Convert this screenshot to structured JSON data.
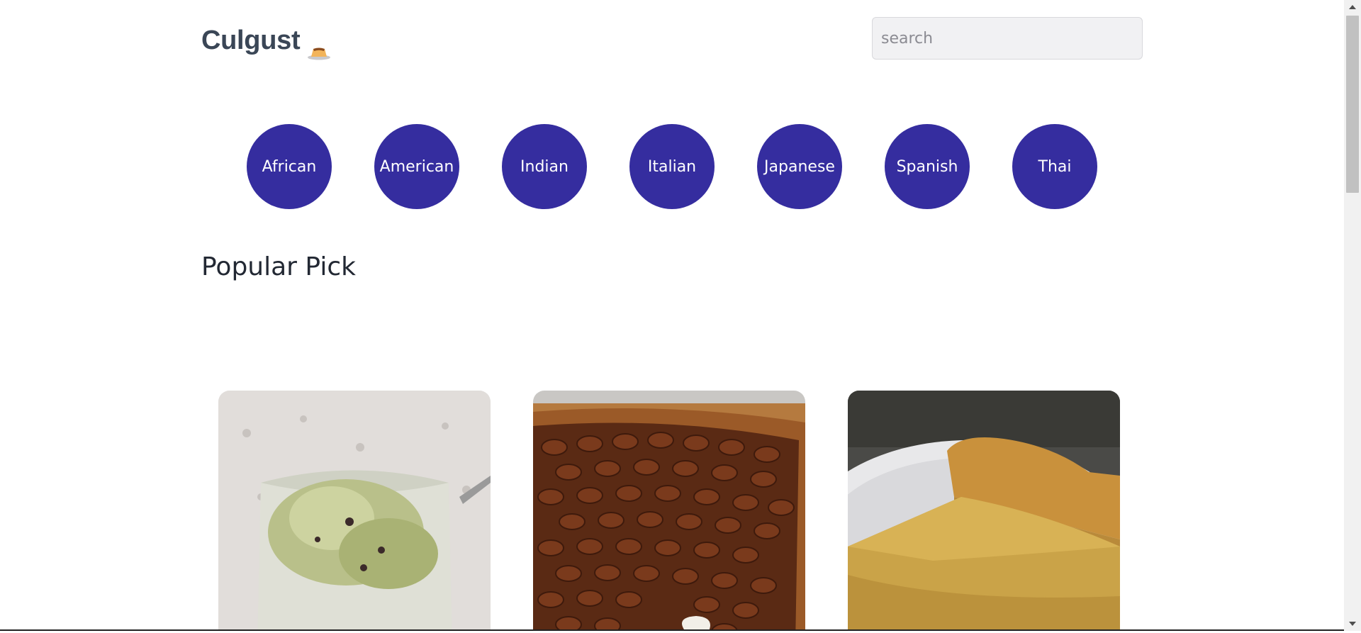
{
  "header": {
    "brand": "Culgust",
    "brand_icon": "flan-icon",
    "search_placeholder": "search"
  },
  "cuisines": [
    "African",
    "American",
    "Indian",
    "Italian",
    "Japanese",
    "Spanish",
    "Thai"
  ],
  "popular": {
    "title": "Popular Pick",
    "cards": [
      {
        "image": "matcha-ice-cream-image"
      },
      {
        "image": "pecan-pie-image"
      },
      {
        "image": "custard-pie-image"
      }
    ]
  },
  "colors": {
    "accent": "#352d9f",
    "brand_text": "#3a4656",
    "title_text": "#222833"
  }
}
